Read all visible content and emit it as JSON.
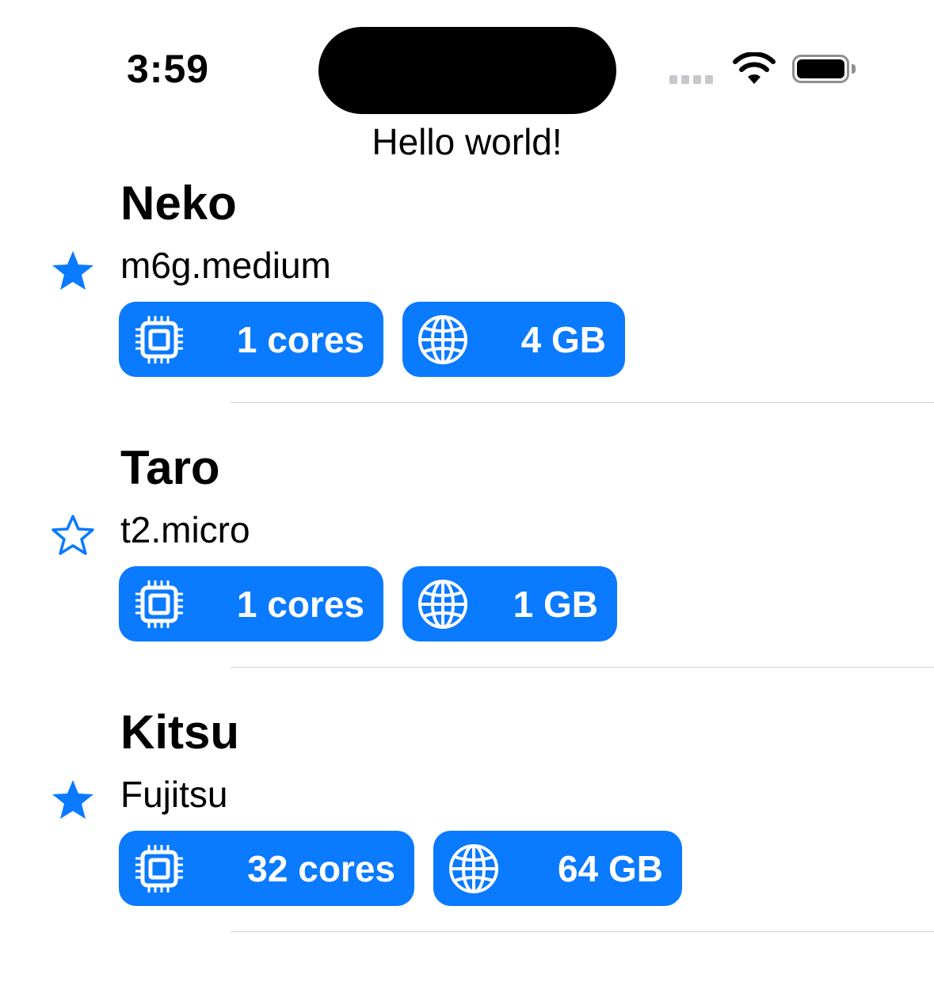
{
  "status_bar": {
    "time": "3:59"
  },
  "header": {
    "title": "Hello world!"
  },
  "accent_color": "#0a7aff",
  "items": [
    {
      "name": "Neko",
      "type": "m6g.medium",
      "favorite": true,
      "cores_label": "1 cores",
      "memory_label": "4 GB"
    },
    {
      "name": "Taro",
      "type": "t2.micro",
      "favorite": false,
      "cores_label": "1 cores",
      "memory_label": "1 GB"
    },
    {
      "name": "Kitsu",
      "type": "Fujitsu",
      "favorite": true,
      "cores_label": "32 cores",
      "memory_label": "64 GB"
    }
  ],
  "icons": {
    "favorite": "star-fill-icon",
    "not_favorite": "star-outline-icon",
    "cores": "cpu-icon",
    "memory": "globe-icon"
  }
}
